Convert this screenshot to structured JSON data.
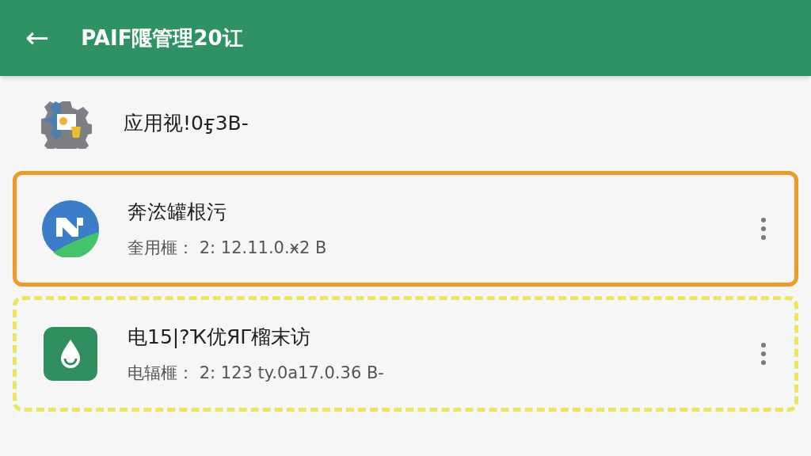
{
  "app_bar": {
    "back": "←",
    "title": "PAIF隁管理20讧"
  },
  "apps": [
    {
      "kind": "gear",
      "name": "应用视!0ӻ3B-"
    },
    {
      "kind": "round",
      "name": "奔㳒罐根污",
      "detail": "奎用榧：  2: 12.11.0.ӿ2 B",
      "color": "#ee9a24",
      "dashed": false
    },
    {
      "kind": "drop",
      "name": "电15|?Ҡ优ЯΓ榴末访",
      "detail": "电辐榧：  2: 123  ty.0a17.0.36 B-",
      "color": "#ece65c",
      "dashed": true
    }
  ]
}
